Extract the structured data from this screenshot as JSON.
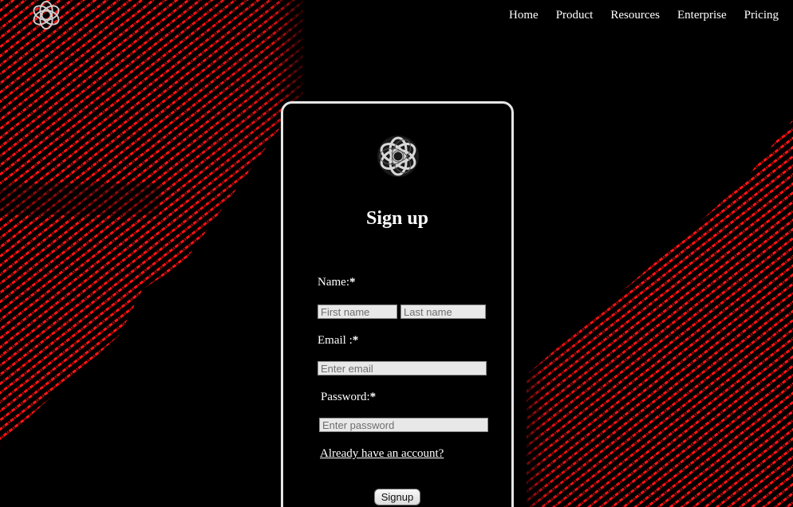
{
  "nav": {
    "items": [
      {
        "label": "Home"
      },
      {
        "label": "Product"
      },
      {
        "label": "Resources"
      },
      {
        "label": "Enterprise"
      },
      {
        "label": "Pricing"
      }
    ]
  },
  "form": {
    "title": "Sign up",
    "name_label": "Name:",
    "email_label": "Email :",
    "password_label": "Password:",
    "required_mark": "*",
    "first_name_placeholder": "First name",
    "last_name_placeholder": "Last name",
    "email_placeholder": "Enter email",
    "password_placeholder": "Enter password",
    "login_link": "Already have an account?",
    "submit_label": "Signup"
  },
  "icons": {
    "logo": "knot-logo-icon",
    "card_logo": "knot-logo-icon"
  },
  "colors": {
    "background": "#000000",
    "accent": "#ff1a1a",
    "card_border": "#e6e6e6"
  }
}
